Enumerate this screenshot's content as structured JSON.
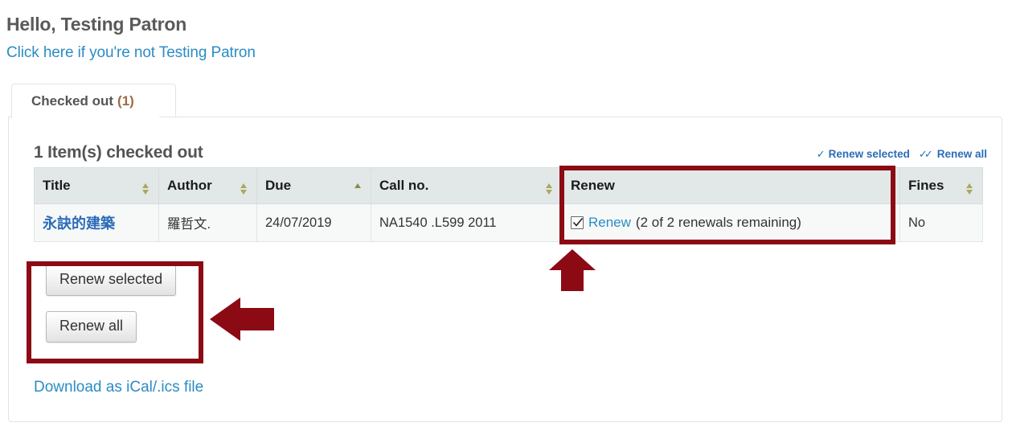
{
  "header": {
    "greeting": "Hello, Testing Patron",
    "not_you_link": "Click here if you're not Testing Patron"
  },
  "tabs": [
    {
      "label": "Checked out",
      "count": "(1)",
      "active": true
    }
  ],
  "panel": {
    "title": "1 Item(s) checked out",
    "bulk_actions": [
      {
        "name": "renew-selected",
        "label": "Renew selected",
        "icon": "check-icon"
      },
      {
        "name": "renew-all",
        "label": "Renew all",
        "icon": "double-check-icon"
      }
    ],
    "table": {
      "columns": [
        {
          "label": "Title",
          "sortable": true,
          "sort": "none"
        },
        {
          "label": "Author",
          "sortable": true,
          "sort": "none"
        },
        {
          "label": "Due",
          "sortable": true,
          "sort": "asc"
        },
        {
          "label": "Call no.",
          "sortable": true,
          "sort": "none"
        },
        {
          "label": "Renew",
          "sortable": false,
          "sort": "none"
        },
        {
          "label": "Fines",
          "sortable": true,
          "sort": "none"
        }
      ],
      "rows": [
        {
          "title": "永訣的建築",
          "author": "羅哲文.",
          "due": "24/07/2019",
          "call_no": "NA1540 .L599 2011",
          "renew_checked": true,
          "renew_link": "Renew",
          "renew_note": "(2 of 2 renewals remaining)",
          "fines": "No"
        }
      ]
    },
    "buttons": [
      {
        "name": "renew-selected-button",
        "label": "Renew selected"
      },
      {
        "name": "renew-all-button",
        "label": "Renew all"
      }
    ],
    "ical_link": "Download as iCal/.ics file"
  },
  "annotations": {
    "highlight_color": "#8b0a14",
    "boxes": [
      {
        "name": "renew-column-highlight"
      },
      {
        "name": "renew-buttons-highlight"
      }
    ],
    "arrows": [
      {
        "name": "arrow-up-to-renew-cell",
        "direction": "up"
      },
      {
        "name": "arrow-left-to-renew-buttons",
        "direction": "left"
      }
    ]
  },
  "colors": {
    "link": "#2b8cc4",
    "heading": "#5a5a5a",
    "table_header_bg": "#e2e8e8",
    "accent_red": "#8b0a14"
  }
}
